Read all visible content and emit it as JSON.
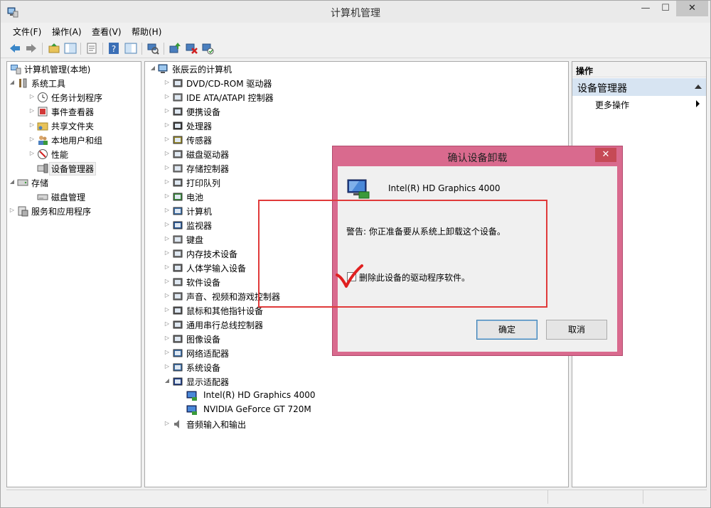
{
  "window": {
    "title": "计算机管理",
    "controls": {
      "minimize": "—",
      "maximize": "☐",
      "close": "✕"
    }
  },
  "menu": [
    "文件(F)",
    "操作(A)",
    "查看(V)",
    "帮助(H)"
  ],
  "left_tree": {
    "root": "计算机管理(本地)",
    "system_tools": "系统工具",
    "system_items": [
      "任务计划程序",
      "事件查看器",
      "共享文件夹",
      "本地用户和组",
      "性能",
      "设备管理器"
    ],
    "storage": "存储",
    "storage_items": [
      "磁盘管理"
    ],
    "services": "服务和应用程序"
  },
  "device_tree": {
    "computer": "张辰云的计算机",
    "categories": [
      "DVD/CD-ROM 驱动器",
      "IDE ATA/ATAPI 控制器",
      "便携设备",
      "处理器",
      "传感器",
      "磁盘驱动器",
      "存储控制器",
      "打印队列",
      "电池",
      "计算机",
      "监视器",
      "键盘",
      "内存技术设备",
      "人体学输入设备",
      "软件设备",
      "声音、视频和游戏控制器",
      "鼠标和其他指针设备",
      "通用串行总线控制器",
      "图像设备",
      "网络适配器",
      "系统设备",
      "显示适配器"
    ],
    "display_adapters": [
      "Intel(R) HD Graphics 4000",
      "NVIDIA GeForce GT 720M"
    ],
    "last": "音频输入和输出"
  },
  "actions": {
    "header": "操作",
    "section": "设备管理器",
    "more": "更多操作"
  },
  "dialog": {
    "title": "确认设备卸载",
    "close": "✕",
    "device": "Intel(R) HD Graphics 4000",
    "warning": "警告: 你正准备要从系统上卸载这个设备。",
    "checkbox_label": "删除此设备的驱动程序软件。",
    "checkbox_checked": false,
    "ok": "确定",
    "cancel": "取消"
  },
  "colors": {
    "dialog_frame": "#d96a8e",
    "annotation": "#e03a3a",
    "selection": "#d7e4f2"
  }
}
